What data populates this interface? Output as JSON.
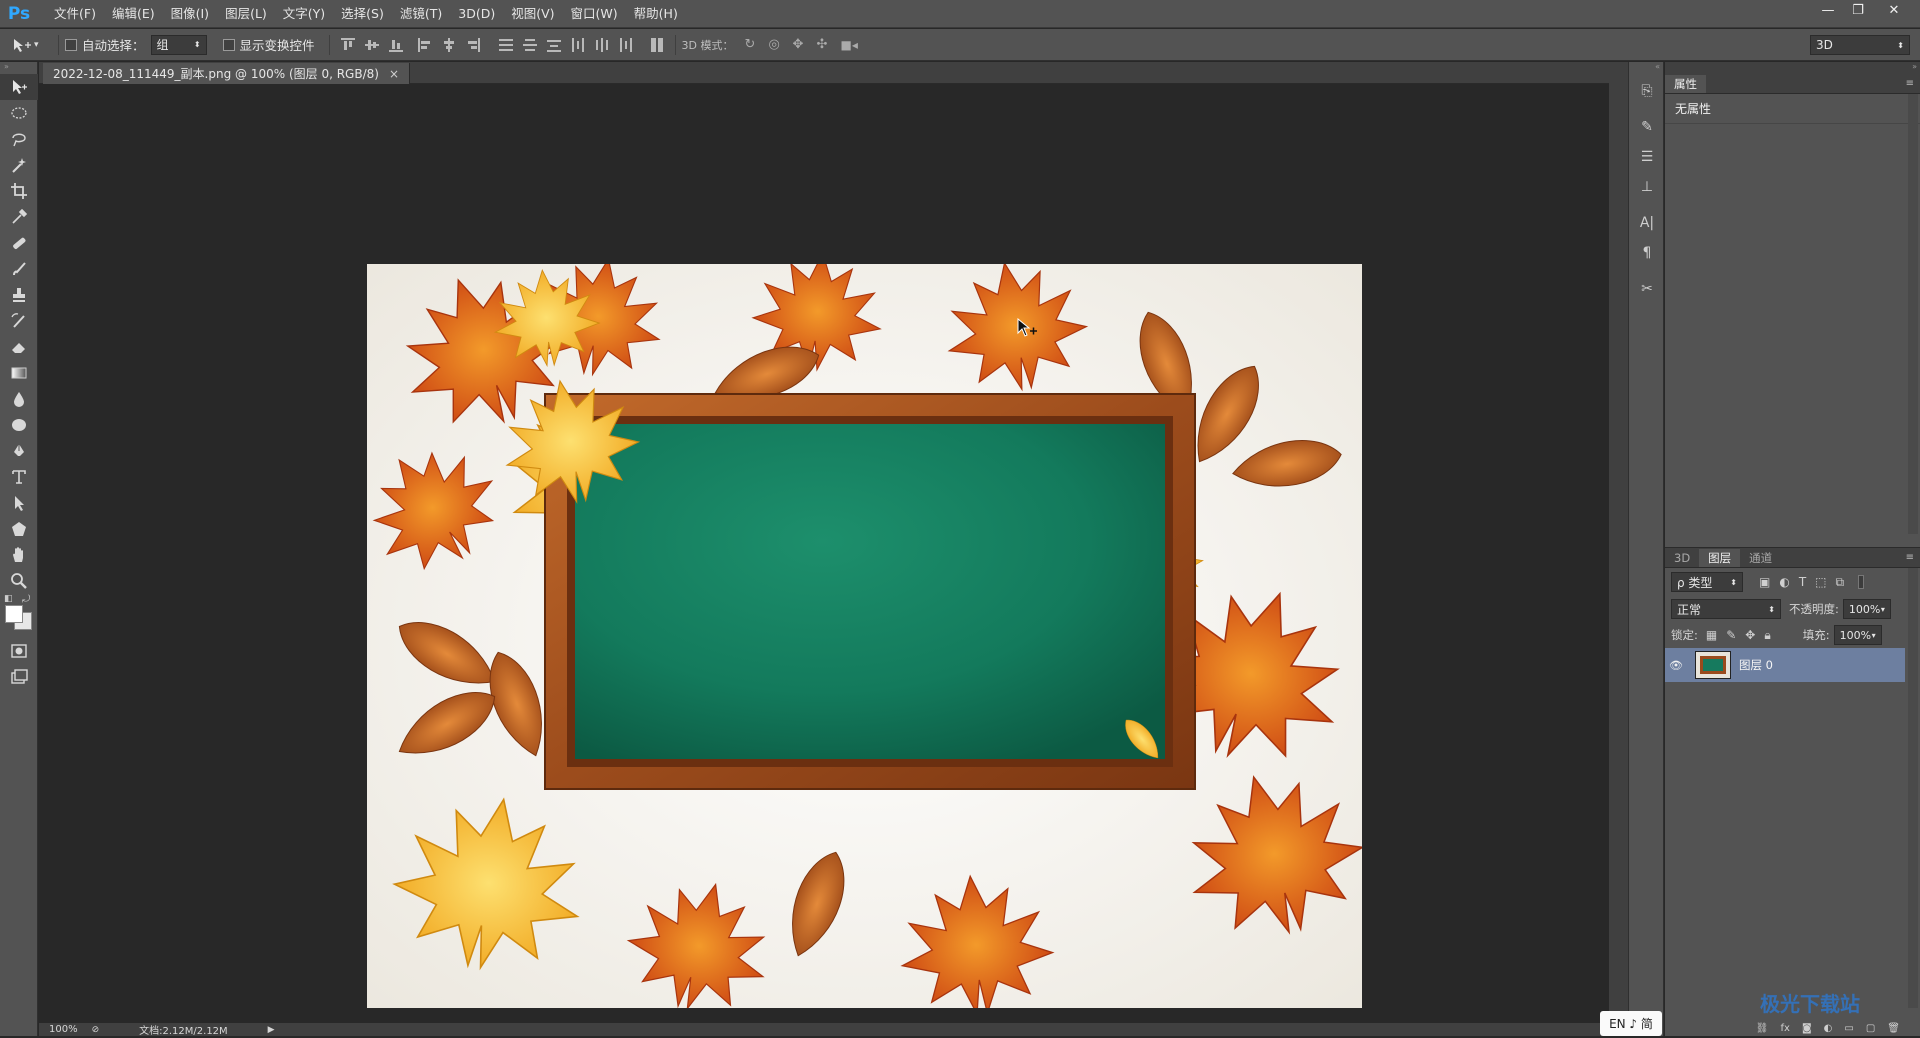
{
  "app": {
    "logo": "Ps"
  },
  "menu": [
    "文件(F)",
    "编辑(E)",
    "图像(I)",
    "图层(L)",
    "文字(Y)",
    "选择(S)",
    "滤镜(T)",
    "3D(D)",
    "视图(V)",
    "窗口(W)",
    "帮助(H)"
  ],
  "options": {
    "auto_select_label": "自动选择：",
    "auto_select_value": "组",
    "show_transform_label": "显示变换控件",
    "mode_3d_label": "3D 模式：",
    "workspace_value": "3D"
  },
  "document": {
    "tab_title": "2022-12-08_111449_副本.png @ 100% (图层 0, RGB/8)",
    "tab_close": "×"
  },
  "status": {
    "zoom": "100%",
    "doc_info": "文档:2.12M/2.12M"
  },
  "properties": {
    "tab": "属性",
    "empty_text": "无属性"
  },
  "layers_panel": {
    "tabs": [
      "3D",
      "图层",
      "通道"
    ],
    "filter_label": "ρ 类型",
    "blend_mode": "正常",
    "opacity_label": "不透明度:",
    "opacity_value": "100%",
    "lock_label": "锁定:",
    "fill_label": "填充:",
    "fill_value": "100%",
    "layers": [
      {
        "name": "图层 0"
      }
    ]
  },
  "ime": {
    "text": "EN ♪ 简"
  },
  "watermark": {
    "text": "极光下载站"
  },
  "colors": {
    "chalkboard": "#137a5c",
    "frame": "#9a4b1d",
    "ui_panel": "#535353",
    "canvas_bg": "#282828",
    "accent": "#30a8ff"
  }
}
